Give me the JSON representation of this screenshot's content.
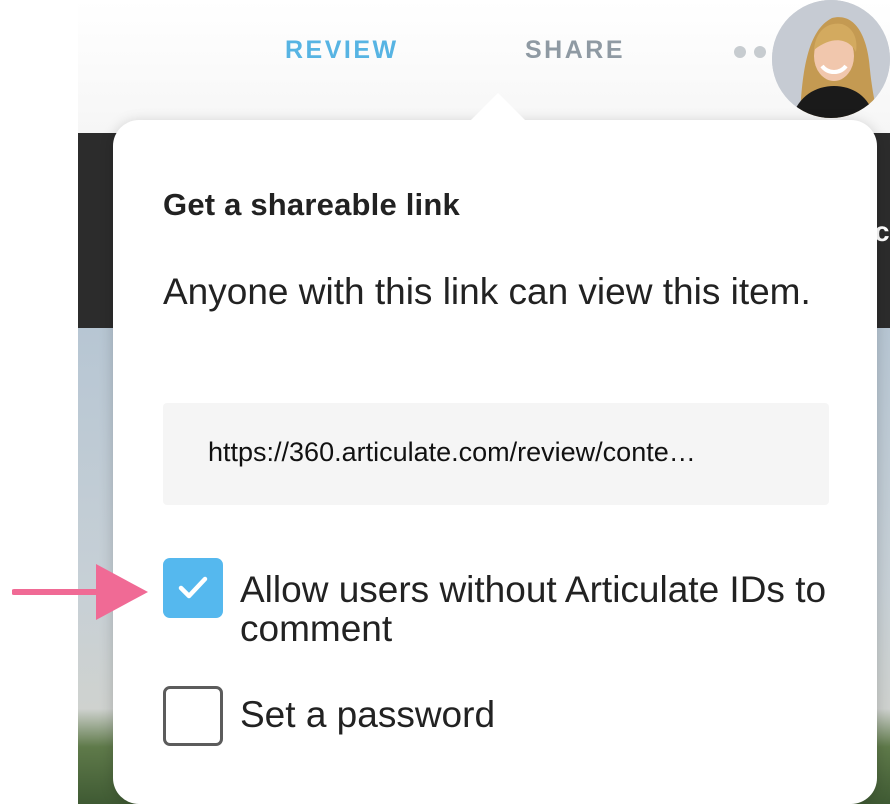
{
  "colors": {
    "accent": "#57b4e3",
    "checkbox_checked": "#55b8ee",
    "annotation_arrow": "#f06a95"
  },
  "header": {
    "tabs": [
      {
        "label": "REVIEW",
        "active": true
      },
      {
        "label": "SHARE",
        "active": false
      }
    ],
    "more_icon": "more-horizontal-icon",
    "avatar_icon": "user-avatar"
  },
  "share_popover": {
    "title": "Get a shareable link",
    "description": "Anyone with this link can view this item.",
    "link_value": "https://360.articulate.com/review/conte…",
    "options": [
      {
        "label": "Allow users without Articulate IDs to comment",
        "checked": true
      },
      {
        "label": "Set a password",
        "checked": false
      }
    ]
  },
  "background": {
    "side_glyph": "c"
  }
}
